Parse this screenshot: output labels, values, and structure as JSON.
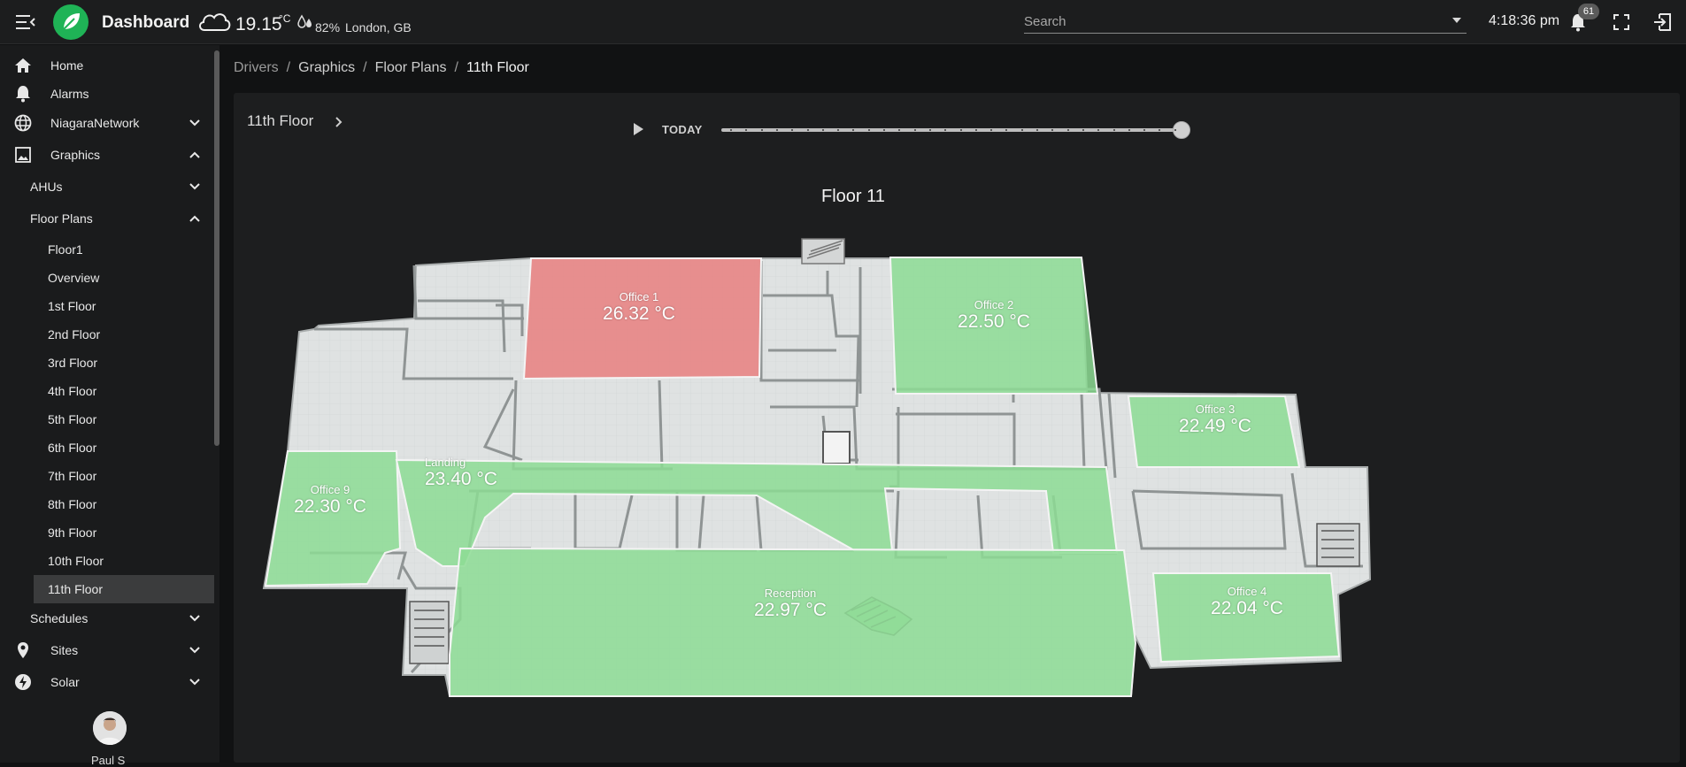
{
  "topbar": {
    "title": "Dashboard",
    "weather": {
      "temperature": "19.15",
      "unit": "°C",
      "humidity": "82%",
      "location": "London, GB",
      "icon": "cloud-icon"
    },
    "search_placeholder": "Search",
    "clock": "4:18:36 pm",
    "notification_count": "61"
  },
  "sidebar": {
    "home": "Home",
    "alarms": "Alarms",
    "niagara_network": "NiagaraNetwork",
    "graphics": "Graphics",
    "ahus": "AHUs",
    "floor_plans": "Floor Plans",
    "floors": [
      "Floor1",
      "Overview",
      "1st Floor",
      "2nd Floor",
      "3rd Floor",
      "4th Floor",
      "5th Floor",
      "6th Floor",
      "7th Floor",
      "8th Floor",
      "9th Floor",
      "10th Floor",
      "11th Floor"
    ],
    "active_floor": "11th Floor",
    "schedules": "Schedules",
    "sites": "Sites",
    "solar": "Solar",
    "user_name": "Paul S"
  },
  "breadcrumb": [
    "Drivers",
    "Graphics",
    "Floor Plans",
    "11th Floor"
  ],
  "panel": {
    "title": "11th Floor",
    "timeline_label": "TODAY",
    "timeline_position": 1.0,
    "floor_title": "Floor 11"
  },
  "zones": {
    "office1": {
      "name": "Office 1",
      "value": "26.32 °C",
      "status_color": "#e97f7f"
    },
    "office2": {
      "name": "Office 2",
      "value": "22.50 °C",
      "status_color": "#8ddc94"
    },
    "office3": {
      "name": "Office 3",
      "value": "22.49 °C",
      "status_color": "#8ddc94"
    },
    "office4": {
      "name": "Office 4",
      "value": "22.04 °C",
      "status_color": "#8ddc94"
    },
    "office9": {
      "name": "Office 9",
      "value": "22.30 °C",
      "status_color": "#8ddc94"
    },
    "landing": {
      "name": "Landing",
      "value": "23.40 °C",
      "status_color": "#8ddc94"
    },
    "reception": {
      "name": "Reception",
      "value": "22.97 °C",
      "status_color": "#8ddc94"
    }
  },
  "colors": {
    "accent": "#1fb356",
    "background": "#111213",
    "panel": "#1d1e1f"
  }
}
